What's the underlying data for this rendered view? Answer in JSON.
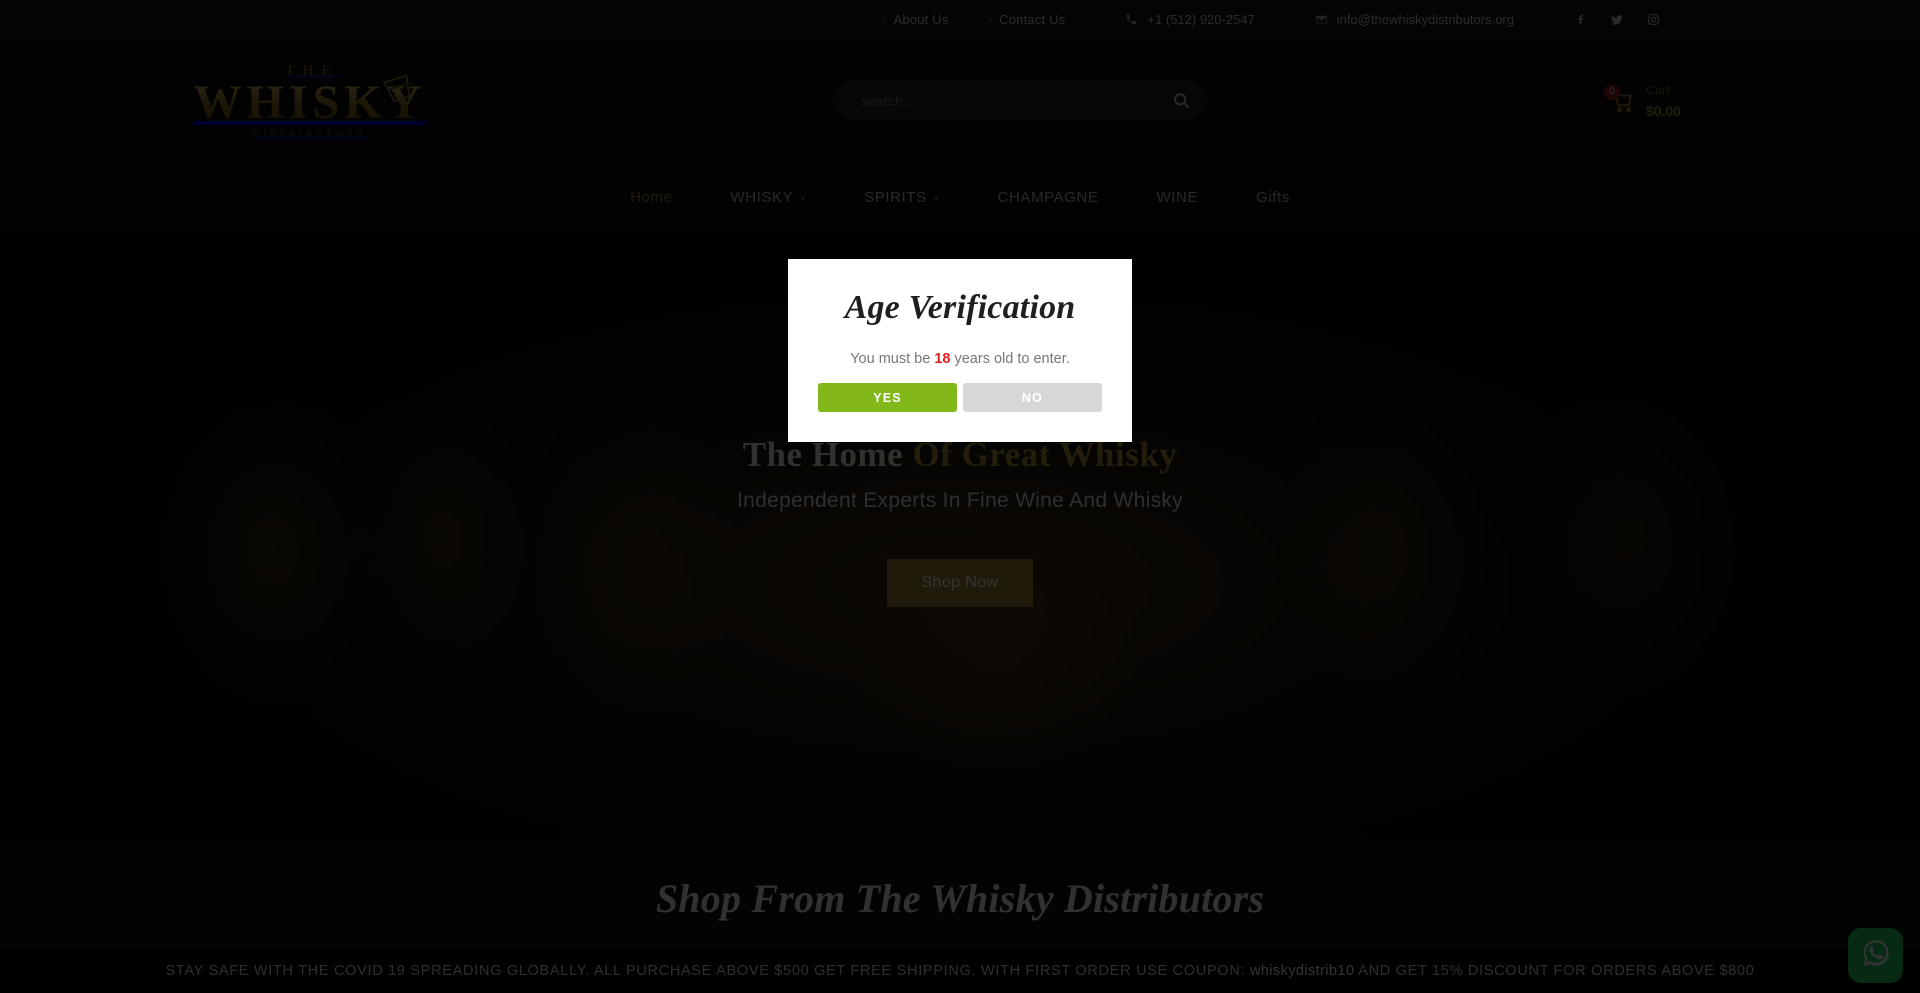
{
  "topbar": {
    "links": [
      {
        "label": "About Us",
        "icon": "chevron-right-icon"
      },
      {
        "label": "Contact Us",
        "icon": "chevron-right-icon"
      }
    ],
    "phone": "+1 (512) 920-2547",
    "email": "info@thewhiskydistributors.org",
    "socials": [
      {
        "name": "facebook-icon"
      },
      {
        "name": "twitter-icon"
      },
      {
        "name": "instagram-icon"
      }
    ]
  },
  "header": {
    "logo": {
      "the": "THE",
      "main": "WHISKY",
      "sub": "DISTRIBUTORS"
    },
    "search": {
      "value": "",
      "placeholder": "search...",
      "icon": "search-icon"
    },
    "cart": {
      "icon": "cart-icon",
      "count": "0",
      "label": "Cart",
      "price": "$0.00"
    }
  },
  "nav": {
    "items": [
      {
        "label": "Home",
        "caret": "",
        "active": true
      },
      {
        "label": "WHISKY",
        "caret": "˅",
        "active": false
      },
      {
        "label": "SPIRITS",
        "caret": "˅",
        "active": false
      },
      {
        "label": "CHAMPAGNE",
        "caret": "",
        "active": false
      },
      {
        "label": "WINE",
        "caret": "",
        "active": false
      },
      {
        "label": "Gifts",
        "caret": "",
        "active": false
      }
    ]
  },
  "hero": {
    "title_plain": "The Home ",
    "title_accent": "Of Great Whisky",
    "subtitle": "Independent Experts In Fine Wine And Whisky",
    "button": "Shop Now"
  },
  "shop_section": {
    "title": "Shop From The Whisky Distributors"
  },
  "promo": {
    "part1": "STAY SAFE WITH THE COVID 19 SPREADING GLOBALLY. ALL PURCHASE ABOVE $500 GET FREE SHIPPING. WITH FIRST ORDER USE COUPON: ",
    "code": "whiskydistrib10",
    "part2": " AND GET 15% DISCOUNT FOR ORDERS ABOVE $800"
  },
  "whatsapp": {
    "icon": "whatsapp-icon"
  },
  "modal": {
    "title": "Age Verification",
    "text_before": "You must be ",
    "age": "18",
    "text_after": " years old to enter.",
    "yes_label": "YES",
    "no_label": "NO"
  },
  "colors": {
    "accent_gold": "#9c8230",
    "yes_green": "#82b819",
    "no_gray": "#d7d7d7",
    "age_red": "#e02020",
    "whatsapp_green": "#25d366"
  }
}
